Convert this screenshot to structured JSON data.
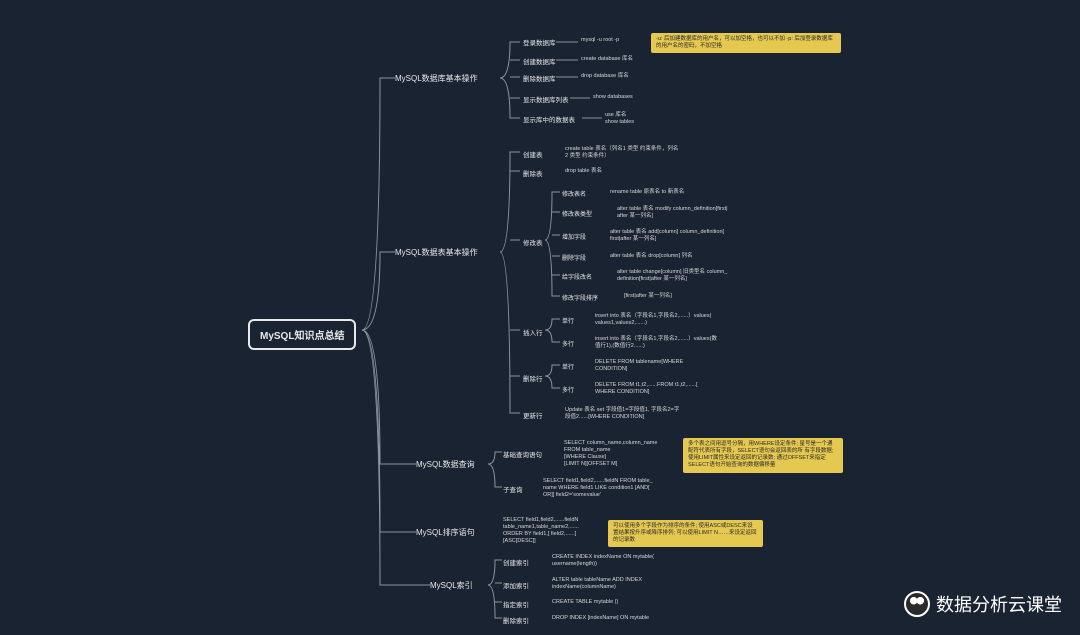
{
  "root": "MySQL知识点总结",
  "watermark": "数据分析云课堂",
  "branches": {
    "b1": {
      "title": "MySQL数据库基本操作",
      "items": {
        "login": "登录数据库",
        "login_cmd": "mysql -u root -p",
        "login_note": "-u: 后加建数据库的用户名，可以加空格，也可以不加\n-p: 后加登录数据库的用户名的密码，不加空格",
        "create": "创建数据库",
        "create_cmd": "create database 库名",
        "drop": "删除数据库",
        "drop_cmd": "drop database 库名",
        "showdb": "显示数据库列表",
        "showdb_cmd": "show databases",
        "showtb": "显示库中的数据表",
        "showtb_cmd": "use 库名\nshow tables"
      }
    },
    "b2": {
      "title": "MySQL数据表基本操作",
      "create_tb": "创建表",
      "create_tb_cmd": "create table 表名（列名1 类型 约束条件，列名\n2 类型 约束条件）",
      "drop_tb": "删除表",
      "drop_tb_cmd": "drop table 表名",
      "modify": "修改表",
      "m_rename": "修改表名",
      "m_rename_cmd": "rename table 原表名 to 新表名",
      "m_type": "修改表类型",
      "m_type_cmd": "alter table 表名 modify column_definition[first|\nafter 某一列名]",
      "m_add": "增加字段",
      "m_add_cmd": "alter table 表名 add[column] column_definition[\nfirst|after 某一列名]",
      "m_del": "删除字段",
      "m_del_cmd": "alter table 表名 drop[column] 列名",
      "m_chg": "给字段改名",
      "m_chg_cmd": "alter table change[column] 旧类型名 column_\ndefinition[first|after 某一列名]",
      "m_ord": "修改字段排序",
      "m_ord_cmd": "[first|after 某一列名]",
      "insert": "插入行",
      "i_single": "单行",
      "i_single_cmd": "insert into 表名（字段名1,字段名2,......）values(\nvalues1,values2,......)",
      "i_multi": "多行",
      "i_multi_cmd": "insert into 表名（字段名1,字段名2,......）values(数\n值行1),(数值行2......)",
      "delete": "删除行",
      "d_single": "单行",
      "d_single_cmd": "DELETE FROM tablename[WHERE\nCONDITION]",
      "d_multi": "多行",
      "d_multi_cmd": "DELETE FROM t1,t2,......FROM t1,t2,......[\nWHERE CONDITION]",
      "update": "更新行",
      "update_cmd": "Update 表名 set 字段值1=字段值1, 字段名2=字\n段值2......[WHERE CONDITION]"
    },
    "b3": {
      "title": "MySQL数据查询",
      "basic": "基础查询语句",
      "basic_cmd": "SELECT column_name,column_name\nFROM table_name\n[WHERE Clause]\n[LIMIT N][OFFSET M]",
      "basic_note": "多个表之间用逗号分隔，用WHERE设定条件;\n星号是一个通配符代表所有字段，SELECT语句会返回表的所\n有字段数据;\n使用LIMIT属性来设定返回的记录数;\n通过OFFSET来指定SELECT语句开始查询的数据偏移量",
      "sub": "子查询",
      "sub_cmd": "SELECT field1,field2,......fieldN FROM table_\nname WHERE field1 LIKE condition1 [AND[\nOR]] field2='somevalue'"
    },
    "b4": {
      "title": "MySQL排序语句",
      "cmd": "SELECT field1,field2,......fieldN\ntable_name1,table_name2,......\nORDER BY field1,[ field2,......]\n[ASC[DESC]]",
      "note": "可以使用多个字段作为排序的条件;\n使用ASC或DESC来设置结果按升序或降序排列;\n可以使用LIMIT N……来设定返回的记录数"
    },
    "b5": {
      "title": "MySQL索引",
      "create": "创建索引",
      "create_cmd": "CREATE INDEX indexName ON mytable(\nusername(length))",
      "add": "添加索引",
      "add_cmd": "ALTER table tableName ADD INDEX\nindexName(columnName)",
      "spec": "指定索引",
      "spec_cmd": "CREATE TABLE mytable ()",
      "drop": "删除索引",
      "drop_cmd": "DROP INDEX [indexName] ON mytable"
    }
  }
}
